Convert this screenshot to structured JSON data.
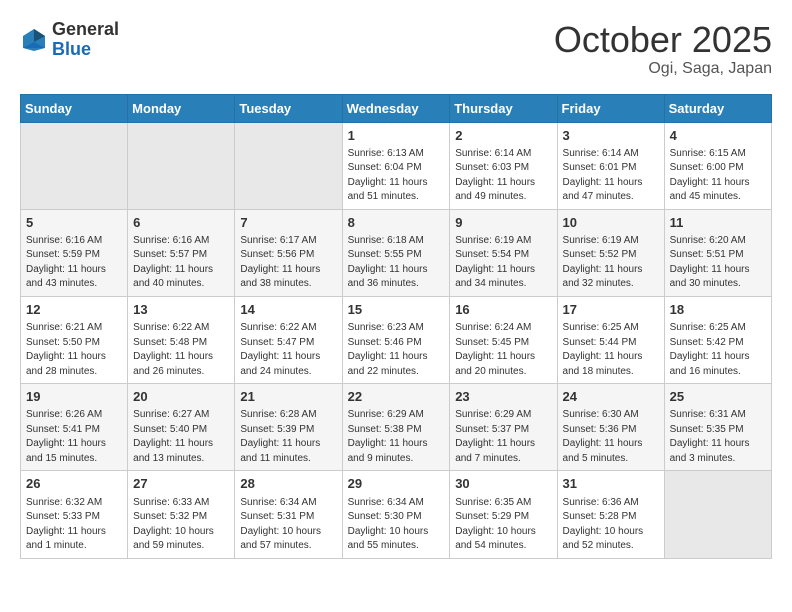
{
  "header": {
    "logo": {
      "general": "General",
      "blue": "Blue",
      "tagline": "General Blue"
    },
    "title": "October 2025",
    "location": "Ogi, Saga, Japan"
  },
  "weekdays": [
    "Sunday",
    "Monday",
    "Tuesday",
    "Wednesday",
    "Thursday",
    "Friday",
    "Saturday"
  ],
  "weeks": [
    {
      "id": "week1",
      "days": [
        {
          "num": "",
          "info": ""
        },
        {
          "num": "",
          "info": ""
        },
        {
          "num": "",
          "info": ""
        },
        {
          "num": "1",
          "info": "Sunrise: 6:13 AM\nSunset: 6:04 PM\nDaylight: 11 hours\nand 51 minutes."
        },
        {
          "num": "2",
          "info": "Sunrise: 6:14 AM\nSunset: 6:03 PM\nDaylight: 11 hours\nand 49 minutes."
        },
        {
          "num": "3",
          "info": "Sunrise: 6:14 AM\nSunset: 6:01 PM\nDaylight: 11 hours\nand 47 minutes."
        },
        {
          "num": "4",
          "info": "Sunrise: 6:15 AM\nSunset: 6:00 PM\nDaylight: 11 hours\nand 45 minutes."
        }
      ]
    },
    {
      "id": "week2",
      "days": [
        {
          "num": "5",
          "info": "Sunrise: 6:16 AM\nSunset: 5:59 PM\nDaylight: 11 hours\nand 43 minutes."
        },
        {
          "num": "6",
          "info": "Sunrise: 6:16 AM\nSunset: 5:57 PM\nDaylight: 11 hours\nand 40 minutes."
        },
        {
          "num": "7",
          "info": "Sunrise: 6:17 AM\nSunset: 5:56 PM\nDaylight: 11 hours\nand 38 minutes."
        },
        {
          "num": "8",
          "info": "Sunrise: 6:18 AM\nSunset: 5:55 PM\nDaylight: 11 hours\nand 36 minutes."
        },
        {
          "num": "9",
          "info": "Sunrise: 6:19 AM\nSunset: 5:54 PM\nDaylight: 11 hours\nand 34 minutes."
        },
        {
          "num": "10",
          "info": "Sunrise: 6:19 AM\nSunset: 5:52 PM\nDaylight: 11 hours\nand 32 minutes."
        },
        {
          "num": "11",
          "info": "Sunrise: 6:20 AM\nSunset: 5:51 PM\nDaylight: 11 hours\nand 30 minutes."
        }
      ]
    },
    {
      "id": "week3",
      "days": [
        {
          "num": "12",
          "info": "Sunrise: 6:21 AM\nSunset: 5:50 PM\nDaylight: 11 hours\nand 28 minutes."
        },
        {
          "num": "13",
          "info": "Sunrise: 6:22 AM\nSunset: 5:48 PM\nDaylight: 11 hours\nand 26 minutes."
        },
        {
          "num": "14",
          "info": "Sunrise: 6:22 AM\nSunset: 5:47 PM\nDaylight: 11 hours\nand 24 minutes."
        },
        {
          "num": "15",
          "info": "Sunrise: 6:23 AM\nSunset: 5:46 PM\nDaylight: 11 hours\nand 22 minutes."
        },
        {
          "num": "16",
          "info": "Sunrise: 6:24 AM\nSunset: 5:45 PM\nDaylight: 11 hours\nand 20 minutes."
        },
        {
          "num": "17",
          "info": "Sunrise: 6:25 AM\nSunset: 5:44 PM\nDaylight: 11 hours\nand 18 minutes."
        },
        {
          "num": "18",
          "info": "Sunrise: 6:25 AM\nSunset: 5:42 PM\nDaylight: 11 hours\nand 16 minutes."
        }
      ]
    },
    {
      "id": "week4",
      "days": [
        {
          "num": "19",
          "info": "Sunrise: 6:26 AM\nSunset: 5:41 PM\nDaylight: 11 hours\nand 15 minutes."
        },
        {
          "num": "20",
          "info": "Sunrise: 6:27 AM\nSunset: 5:40 PM\nDaylight: 11 hours\nand 13 minutes."
        },
        {
          "num": "21",
          "info": "Sunrise: 6:28 AM\nSunset: 5:39 PM\nDaylight: 11 hours\nand 11 minutes."
        },
        {
          "num": "22",
          "info": "Sunrise: 6:29 AM\nSunset: 5:38 PM\nDaylight: 11 hours\nand 9 minutes."
        },
        {
          "num": "23",
          "info": "Sunrise: 6:29 AM\nSunset: 5:37 PM\nDaylight: 11 hours\nand 7 minutes."
        },
        {
          "num": "24",
          "info": "Sunrise: 6:30 AM\nSunset: 5:36 PM\nDaylight: 11 hours\nand 5 minutes."
        },
        {
          "num": "25",
          "info": "Sunrise: 6:31 AM\nSunset: 5:35 PM\nDaylight: 11 hours\nand 3 minutes."
        }
      ]
    },
    {
      "id": "week5",
      "days": [
        {
          "num": "26",
          "info": "Sunrise: 6:32 AM\nSunset: 5:33 PM\nDaylight: 11 hours\nand 1 minute."
        },
        {
          "num": "27",
          "info": "Sunrise: 6:33 AM\nSunset: 5:32 PM\nDaylight: 10 hours\nand 59 minutes."
        },
        {
          "num": "28",
          "info": "Sunrise: 6:34 AM\nSunset: 5:31 PM\nDaylight: 10 hours\nand 57 minutes."
        },
        {
          "num": "29",
          "info": "Sunrise: 6:34 AM\nSunset: 5:30 PM\nDaylight: 10 hours\nand 55 minutes."
        },
        {
          "num": "30",
          "info": "Sunrise: 6:35 AM\nSunset: 5:29 PM\nDaylight: 10 hours\nand 54 minutes."
        },
        {
          "num": "31",
          "info": "Sunrise: 6:36 AM\nSunset: 5:28 PM\nDaylight: 10 hours\nand 52 minutes."
        },
        {
          "num": "",
          "info": ""
        }
      ]
    }
  ]
}
